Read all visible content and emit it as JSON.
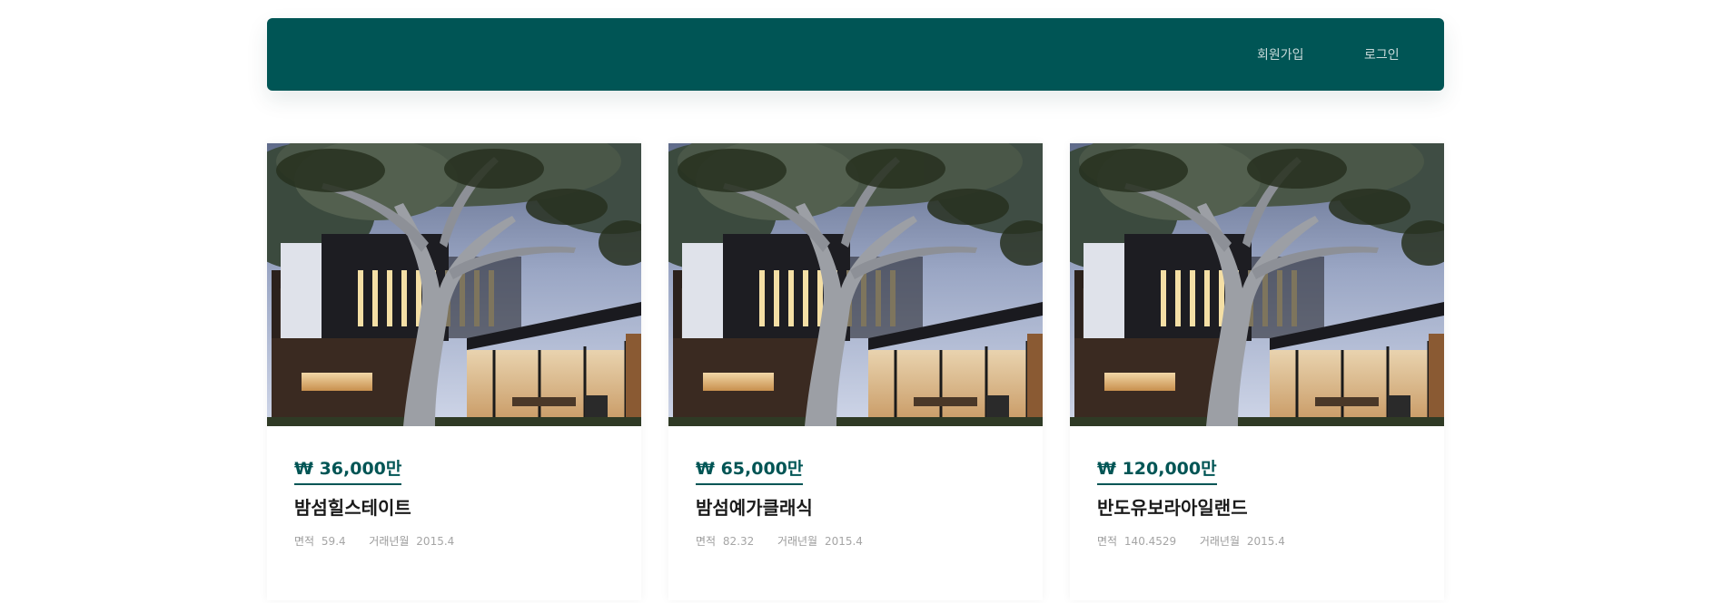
{
  "nav": {
    "signup": "회원가입",
    "login": "로그인"
  },
  "cards": [
    {
      "price": "₩ 36,000만",
      "name": "밤섬힐스테이트",
      "area_label": "면적",
      "area": "59.4",
      "deal_label": "거래년월",
      "deal": "2015.4"
    },
    {
      "price": "₩ 65,000만",
      "name": "밤섬예가클래식",
      "area_label": "면적",
      "area": "82.32",
      "deal_label": "거래년월",
      "deal": "2015.4"
    },
    {
      "price": "₩ 120,000만",
      "name": "반도유보라아일랜드",
      "area_label": "면적",
      "area": "140.4529",
      "deal_label": "거래년월",
      "deal": "2015.4"
    }
  ],
  "colors": {
    "brand": "#005555",
    "text": "#1a1a1a",
    "muted": "#9a9a9a"
  },
  "icons": {
    "photo": "house-photo-icon"
  }
}
